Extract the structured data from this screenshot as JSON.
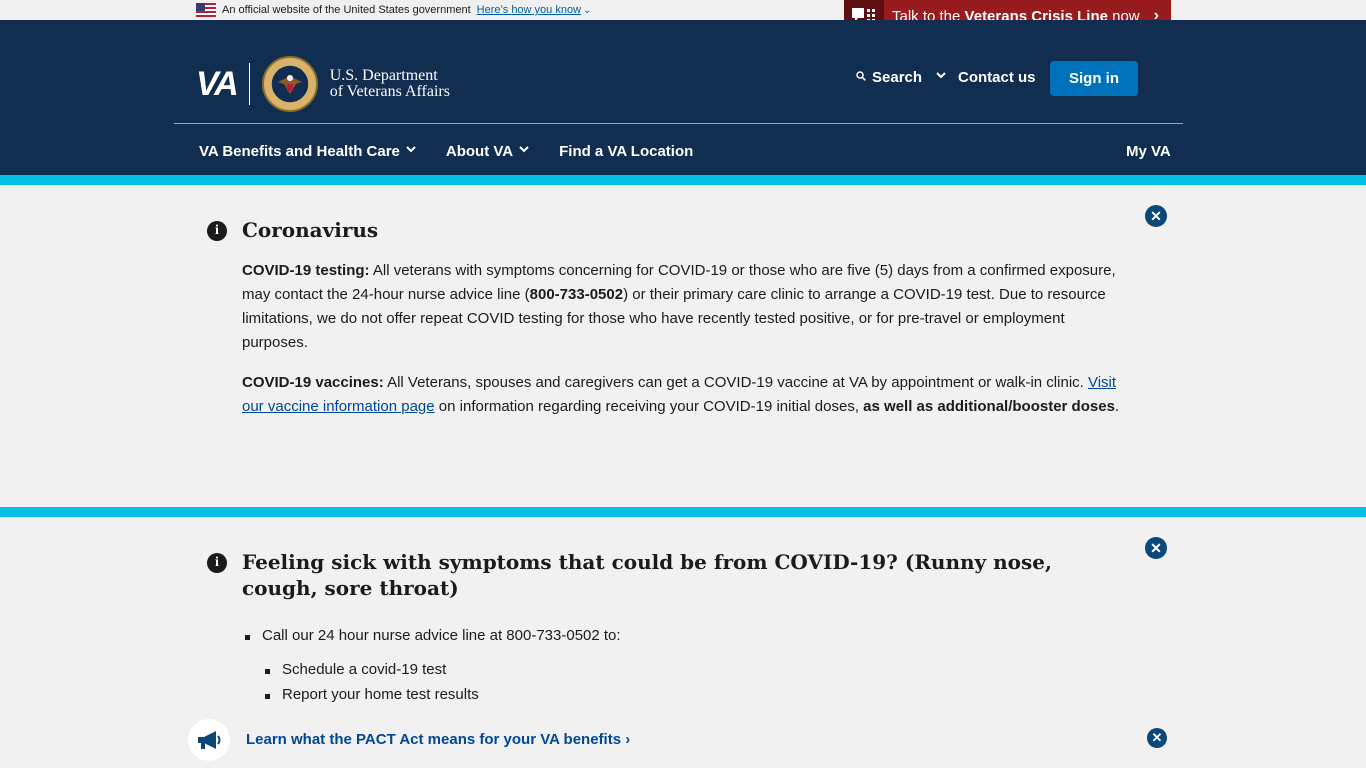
{
  "gov_banner": {
    "text": "An official website of the United States government",
    "link": "Here’s how you know",
    "chevron": "⌄"
  },
  "crisis_line": {
    "prefix": "Talk to the ",
    "bold": "Veterans Crisis Line",
    "suffix": " now",
    "chevron": "›"
  },
  "header": {
    "logo_abbrev": "VA",
    "logo_line1": "U.S. Department",
    "logo_line2": "of Veterans Affairs",
    "search_label": "Search",
    "contact_label": "Contact us",
    "signin_label": "Sign in"
  },
  "nav": {
    "items": [
      {
        "label": "VA Benefits and Health Care",
        "chevron": "⌄"
      },
      {
        "label": "About VA",
        "chevron": "⌄"
      },
      {
        "label": "Find a VA Location",
        "chevron": ""
      }
    ],
    "myva": "My VA"
  },
  "alert1": {
    "title": "Coronavirus",
    "testing_bold": "COVID-19 testing:",
    "testing_text1": " All veterans with symptoms concerning for COVID-19 or those who are five (5) days from a confirmed exposure, may contact the 24-hour nurse advice line (",
    "testing_phone": "800-733-0502",
    "testing_text2": ") or their primary care clinic to arrange a COVID-19 test. Due to resource limitations, we do not offer repeat COVID testing for those who have recently tested positive, or for pre-travel or employment purposes.",
    "vaccine_bold": "COVID-19 vaccines:",
    "vaccine_text1": " All Veterans, spouses and caregivers can get a COVID-19 vaccine at VA by appointment or walk-in clinic. ",
    "vaccine_link": "Visit our vaccine information page",
    "vaccine_text2": " on information regarding receiving your COVID-19 initial doses, ",
    "vaccine_bold2": "as well as additional/booster doses",
    "vaccine_end": "."
  },
  "alert2": {
    "title": "Feeling sick with symptoms that could be from COVID-19? (Runny nose, cough, sore throat)",
    "item1": "Call our 24 hour nurse advice line at 800-733-0502 to:",
    "sub1": "Schedule a covid-19 test",
    "sub2": "Report your home test results"
  },
  "pact": {
    "link": "Learn what the PACT Act means for your VA benefits",
    "chevron": "›"
  },
  "icons": {
    "info": "i",
    "close": "✕"
  },
  "colors": {
    "header_bg": "#112e51",
    "accent_bar": "#02bfe7",
    "crisis_red": "#981b1e",
    "signin_blue": "#0071bb",
    "link_blue": "#004795"
  }
}
